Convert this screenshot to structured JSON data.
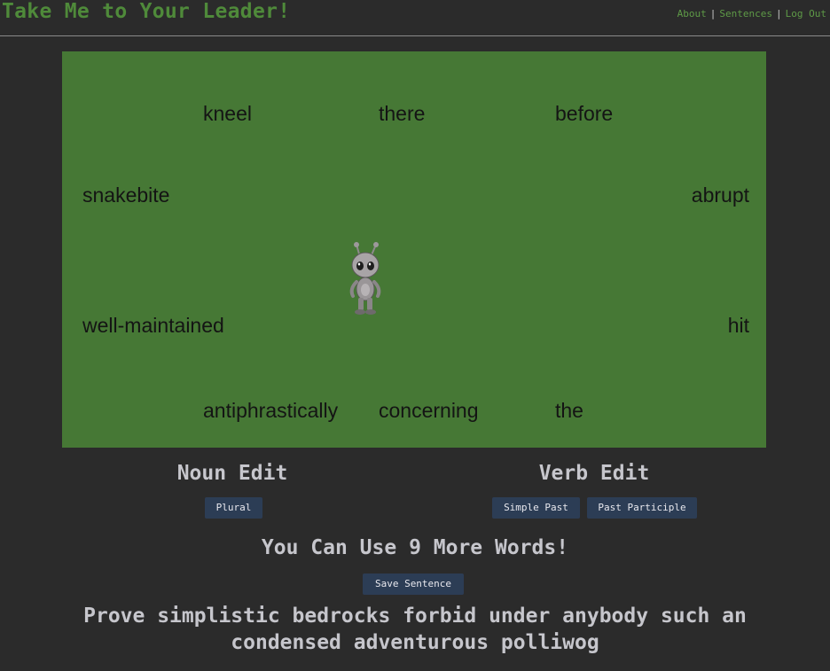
{
  "header": {
    "title": "Take Me to Your Leader!",
    "nav": [
      "About",
      "Sentences",
      "Log Out"
    ]
  },
  "board": {
    "words": [
      "kneel",
      "there",
      "before",
      "snakebite",
      "abrupt",
      "well-maintained",
      "hit",
      "antiphrastically",
      "concerning",
      "the"
    ],
    "colors": {
      "background": "#467835",
      "text": "#141414"
    }
  },
  "noun_edit": {
    "title": "Noun Edit",
    "buttons": [
      "Plural"
    ]
  },
  "verb_edit": {
    "title": "Verb Edit",
    "buttons": [
      "Simple Past",
      "Past Participle"
    ]
  },
  "words_remaining": "You Can Use 9 More Words!",
  "save_button": "Save Sentence",
  "sentence": {
    "line1": "Prove simplistic bedrocks forbid under anybody such an",
    "line2": "condensed adventurous polliwog"
  },
  "colors": {
    "page_background": "#2b2b2b",
    "title_green": "#4f8a3a",
    "button_bg": "#2c3d55",
    "heading_text": "#c6c6cc"
  }
}
